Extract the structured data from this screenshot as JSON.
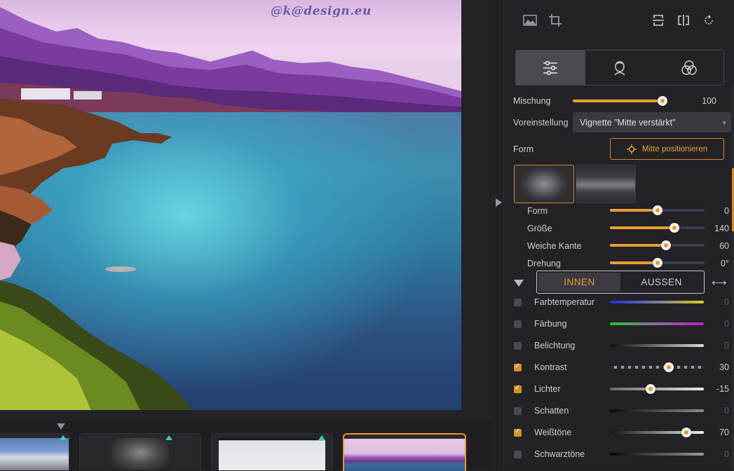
{
  "viewer": {
    "watermark": "@k@design.eu"
  },
  "filmstrip": {
    "thumbnails": 4,
    "selected_index": 3
  },
  "toolbar": {
    "left_icons": [
      "image-icon",
      "crop-icon"
    ],
    "right_icons": [
      "flip-vertical-icon",
      "flip-horizontal-icon",
      "rotate-icon"
    ]
  },
  "mode_tabs": [
    {
      "icon": "adjust-sliders-icon",
      "active": true
    },
    {
      "icon": "portrait-icon",
      "active": false
    },
    {
      "icon": "color-circles-icon",
      "active": false
    }
  ],
  "mix": {
    "label": "Mischung",
    "value": "100",
    "level": 1.0
  },
  "preset": {
    "label": "Voreinstellung",
    "value": "Vignette \"Mitte verstärkt\""
  },
  "form": {
    "label": "Form",
    "center_button": "Mitte positionieren"
  },
  "shape_sliders": [
    {
      "label": "Form",
      "value": "0",
      "level": 0.5
    },
    {
      "label": "Größe",
      "value": "140",
      "level": 0.68
    },
    {
      "label": "Weiche Kante",
      "value": "60",
      "level": 0.59
    },
    {
      "label": "Drehung",
      "value": "0°",
      "level": 0.5
    }
  ],
  "io_toggle": {
    "inner": "INNEN",
    "outer": "AUSSEN",
    "active": "inner"
  },
  "adjustments": [
    {
      "label": "Farbtemperatur",
      "checked": false,
      "value": "0",
      "style": "temperature"
    },
    {
      "label": "Färbung",
      "checked": false,
      "value": "0",
      "style": "tint"
    },
    {
      "label": "Belichtung",
      "checked": false,
      "value": "0",
      "style": "exposure"
    },
    {
      "label": "Kontrast",
      "checked": true,
      "value": "30",
      "style": "contrast",
      "level": 0.63
    },
    {
      "label": "Lichter",
      "checked": true,
      "value": "-15",
      "style": "highlights",
      "level": 0.43
    },
    {
      "label": "Schatten",
      "checked": false,
      "value": "0",
      "style": "shadows"
    },
    {
      "label": "Weißtöne",
      "checked": true,
      "value": "70",
      "style": "whites",
      "level": 0.81
    },
    {
      "label": "Schwarztöne",
      "checked": false,
      "value": "0",
      "style": "blacks"
    }
  ],
  "colors": {
    "accent": "#e8a030",
    "panel_bg": "#232227",
    "active_tab_bg": "#4a4a50"
  }
}
